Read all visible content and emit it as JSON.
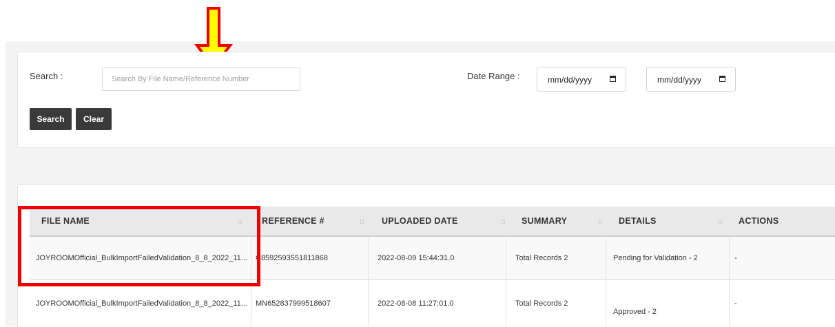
{
  "search": {
    "label": "Search :",
    "placeholder": "Search By File Name/Reference Number",
    "value": ""
  },
  "date_range": {
    "label": "Date Range :",
    "from_value": "mm/dd/yyyy",
    "to_value": "mm/dd/yyyy",
    "icon": "calendar-icon"
  },
  "buttons": {
    "search": "Search",
    "clear": "Clear"
  },
  "table": {
    "headers": [
      "FILE NAME",
      "REFERENCE #",
      "UPLOADED DATE",
      "SUMMARY",
      "DETAILS",
      "ACTIONS"
    ],
    "rows": [
      {
        "file_name": "JOYROOMOfficial_BulkImportFailedValidation_8_8_2022_11...",
        "reference": "C8592593551811868",
        "uploaded_date": "2022-08-09 15:44:31.0",
        "summary": "Total Records 2",
        "details": "Pending for Validation - 2",
        "actions": "-"
      },
      {
        "file_name": "JOYROOMOfficial_BulkImportFailedValidation_8_8_2022_11...",
        "reference": "MN652837999518607",
        "uploaded_date": "2022-08-08 11:27:01.0",
        "summary": "Total Records 2",
        "details": "Approved - 2",
        "actions": "-"
      }
    ]
  },
  "colors": {
    "annotation_red": "#ee0000",
    "arrow_fill": "#ffff00",
    "button_bg": "#3a3a3a"
  }
}
